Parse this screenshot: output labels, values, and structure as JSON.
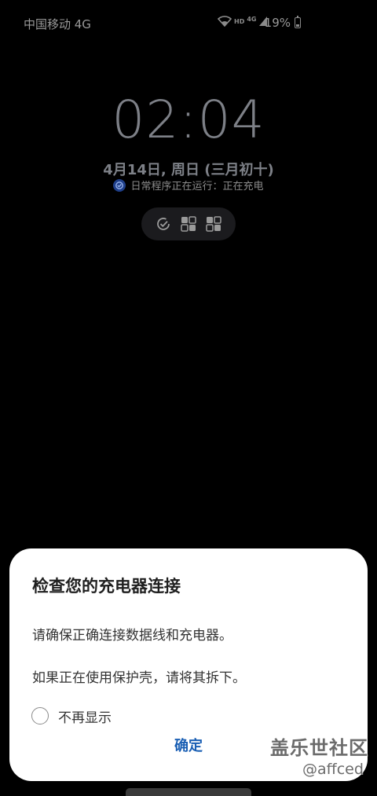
{
  "status_bar": {
    "carrier": "中国移动 4G",
    "hd_label": "HD",
    "network_label": "4G",
    "battery_percent": "19%",
    "icons": [
      "wifi-icon",
      "hd-icon",
      "signal-icon",
      "battery-icon"
    ]
  },
  "lockscreen": {
    "time": "02:04",
    "date": "4月14日, 周日 (三月初十)",
    "routine_text": "日常程序正在运行：正在充电",
    "quick_icons": [
      "routine-check-icon",
      "dual-app-icon-1",
      "dual-app-icon-2"
    ]
  },
  "dialog": {
    "title": "检查您的充电器连接",
    "line1": "请确保正确连接数据线和充电器。",
    "line2": "如果正在使用保护壳，请将其拆下。",
    "checkbox_label": "不再显示",
    "checkbox_checked": false,
    "ok_label": "确定",
    "accent_color": "#1a5fb4"
  },
  "watermark": {
    "brand": "盖乐世社区",
    "handle": "@affced"
  }
}
